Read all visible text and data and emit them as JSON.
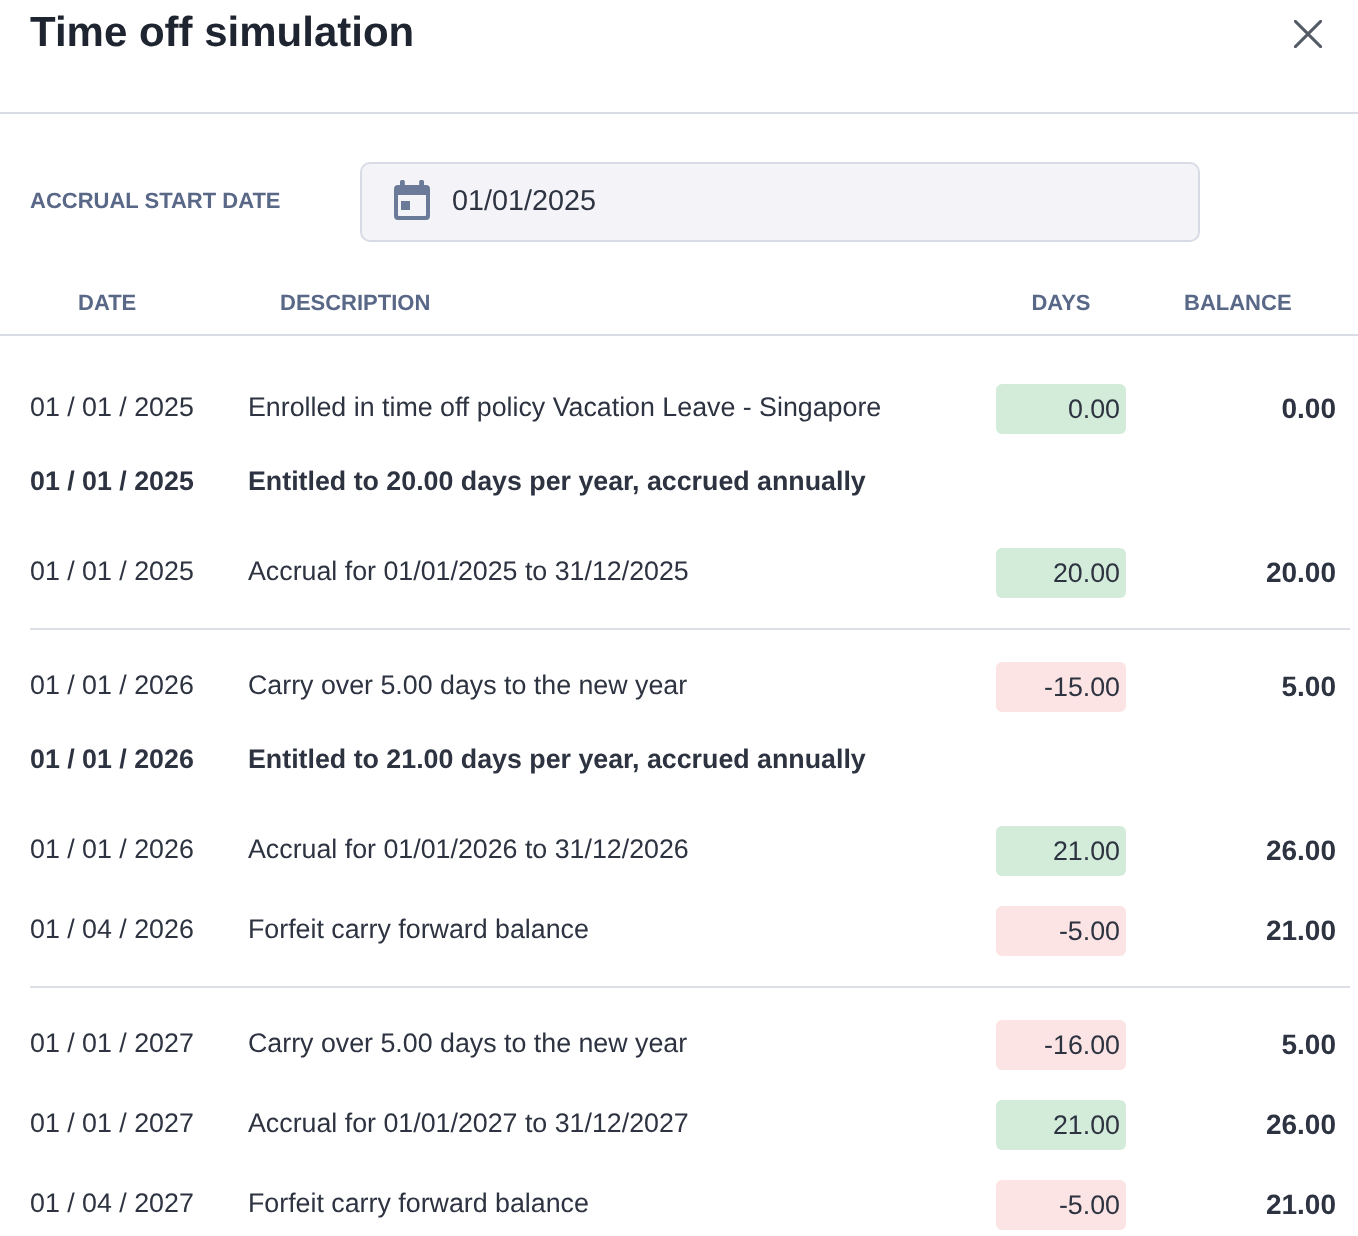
{
  "dialog": {
    "title": "Time off simulation"
  },
  "accrual_start_date": {
    "label": "ACCRUAL START DATE",
    "value": "01/01/2025"
  },
  "table": {
    "columns": [
      "DATE",
      "DESCRIPTION",
      "DAYS",
      "BALANCE"
    ],
    "groups": [
      {
        "rows": [
          {
            "kind": "entry",
            "date": "01 / 01 / 2025",
            "description": "Enrolled in time off policy Vacation Leave - Singapore",
            "days": "0.00",
            "color": "#d3ecd9",
            "balance": "0.00"
          },
          {
            "kind": "entitlement",
            "date": "01 / 01 / 2025",
            "description": "Entitled to 20.00 days per year, accrued annually"
          },
          {
            "kind": "entry",
            "date": "01 / 01 / 2025",
            "description": "Accrual for 01/01/2025 to 31/12/2025",
            "days": "20.00",
            "color": "#d3ecd9",
            "balance": "20.00"
          }
        ]
      },
      {
        "rows": [
          {
            "kind": "entry",
            "date": "01 / 01 / 2026",
            "description": "Carry over 5.00 days to the new year",
            "days": "-15.00",
            "color": "#fce4e4",
            "balance": "5.00"
          },
          {
            "kind": "entitlement",
            "date": "01 / 01 / 2026",
            "description": "Entitled to 21.00 days per year, accrued annually"
          },
          {
            "kind": "entry",
            "date": "01 / 01 / 2026",
            "description": "Accrual for 01/01/2026 to 31/12/2026",
            "days": "21.00",
            "color": "#d3ecd9",
            "balance": "26.00"
          },
          {
            "kind": "entry",
            "date": "01 / 04 / 2026",
            "description": "Forfeit carry forward balance",
            "days": "-5.00",
            "color": "#fce4e4",
            "balance": "21.00"
          }
        ]
      },
      {
        "rows": [
          {
            "kind": "entry",
            "date": "01 / 01 / 2027",
            "description": "Carry over 5.00 days to the new year",
            "days": "-16.00",
            "color": "#fce4e4",
            "balance": "5.00"
          },
          {
            "kind": "entry",
            "date": "01 / 01 / 2027",
            "description": "Accrual for 01/01/2027 to 31/12/2027",
            "days": "21.00",
            "color": "#d3ecd9",
            "balance": "26.00"
          },
          {
            "kind": "entry",
            "date": "01 / 04 / 2027",
            "description": "Forfeit carry forward balance",
            "days": "-5.00",
            "color": "#fce4e4",
            "balance": "21.00"
          }
        ]
      }
    ]
  }
}
